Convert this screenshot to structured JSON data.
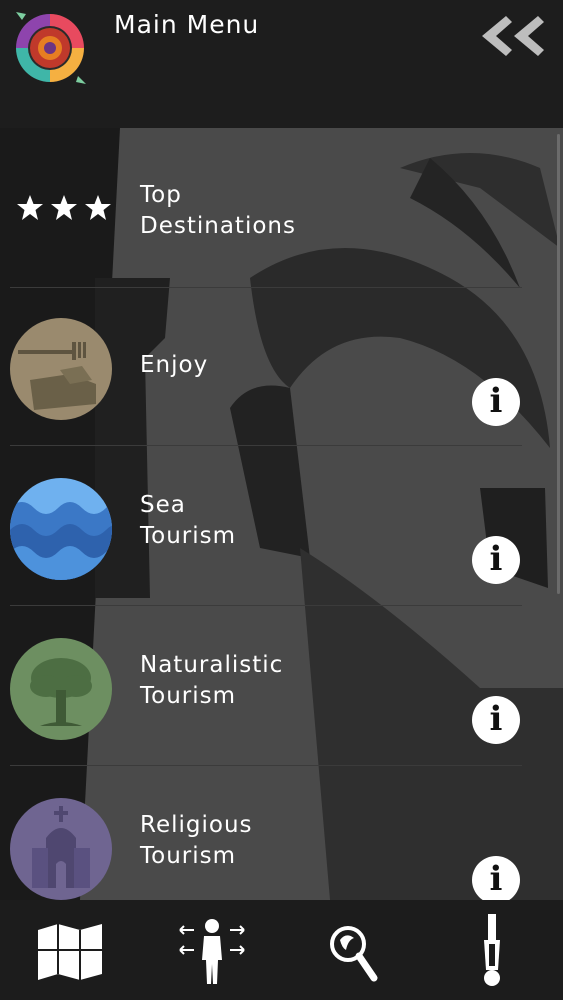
{
  "header": {
    "title": "Main Menu"
  },
  "menu": {
    "items": [
      {
        "line1": "Top",
        "line2": "Destinations",
        "icon": "three-stars-icon"
      },
      {
        "line1": "Enjoy",
        "line2": "",
        "icon": "enjoy-restaurant-icon"
      },
      {
        "line1": "Sea",
        "line2": "Tourism",
        "icon": "sea-waves-icon"
      },
      {
        "line1": "Naturalistic",
        "line2": "Tourism",
        "icon": "tree-icon"
      },
      {
        "line1": "Religious",
        "line2": "Tourism",
        "icon": "church-icon"
      }
    ],
    "info_label": "i"
  },
  "bottom_nav": {
    "items": [
      {
        "icon": "map-icon"
      },
      {
        "icon": "person-directions-icon"
      },
      {
        "icon": "magnifier-icon"
      },
      {
        "icon": "screwdriver-icon"
      }
    ]
  },
  "colors": {
    "header_bg": "#1d1d1d",
    "main_bg": "#171717",
    "enjoy_circle": "#9a8a6e",
    "sea_circle": "#4f8fd8",
    "nature_circle": "#6d8f61",
    "church_circle": "#6f6591"
  }
}
